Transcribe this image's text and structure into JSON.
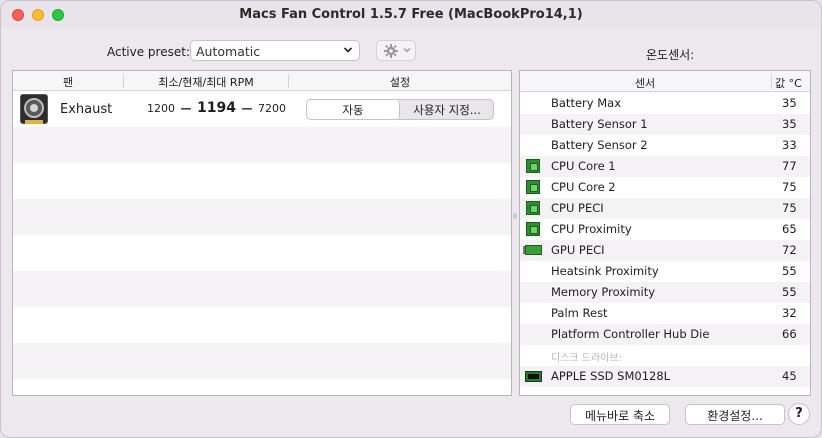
{
  "window": {
    "title": "Macs Fan Control 1.5.7 Free (MacBookPro14,1)"
  },
  "preset": {
    "label": "Active preset:",
    "selected": "Automatic"
  },
  "icons": {
    "dropdown": "chevron-down-icon",
    "gear": "gear-icon"
  },
  "sensors_section_title": "온도센서:",
  "fan_table": {
    "headers": [
      "팬",
      "최소/현재/최대 RPM",
      "설정"
    ],
    "rows": [
      {
        "name": "Exhaust",
        "min": "1200",
        "current": "1194",
        "max": "7200",
        "mode_auto": "자동",
        "mode_custom": "사용자 지정..."
      }
    ]
  },
  "sensor_table": {
    "headers": {
      "name": "센서",
      "value": "값 °C"
    },
    "rows": [
      {
        "name": "Battery Max",
        "value": "35",
        "icon": ""
      },
      {
        "name": "Battery Sensor 1",
        "value": "35",
        "icon": ""
      },
      {
        "name": "Battery Sensor 2",
        "value": "33",
        "icon": ""
      },
      {
        "name": "CPU Core 1",
        "value": "77",
        "icon": "cpu-chip-icon"
      },
      {
        "name": "CPU Core 2",
        "value": "75",
        "icon": "cpu-chip-icon"
      },
      {
        "name": "CPU PECI",
        "value": "75",
        "icon": "cpu-chip-icon"
      },
      {
        "name": "CPU Proximity",
        "value": "65",
        "icon": "cpu-chip-icon"
      },
      {
        "name": "GPU PECI",
        "value": "72",
        "icon": "gpu-card-icon"
      },
      {
        "name": "Heatsink Proximity",
        "value": "55",
        "icon": ""
      },
      {
        "name": "Memory Proximity",
        "value": "55",
        "icon": ""
      },
      {
        "name": "Palm Rest",
        "value": "32",
        "icon": ""
      },
      {
        "name": "Platform Controller Hub Die",
        "value": "66",
        "icon": ""
      },
      {
        "name": "디스크 드라이브:",
        "value": "",
        "icon": ""
      },
      {
        "name": "APPLE SSD SM0128L",
        "value": "45",
        "icon": "ssd-icon"
      }
    ]
  },
  "footer": {
    "menubar_button": "메뉴바로 축소",
    "prefs_button": "환경설정...",
    "help_button": "?"
  }
}
